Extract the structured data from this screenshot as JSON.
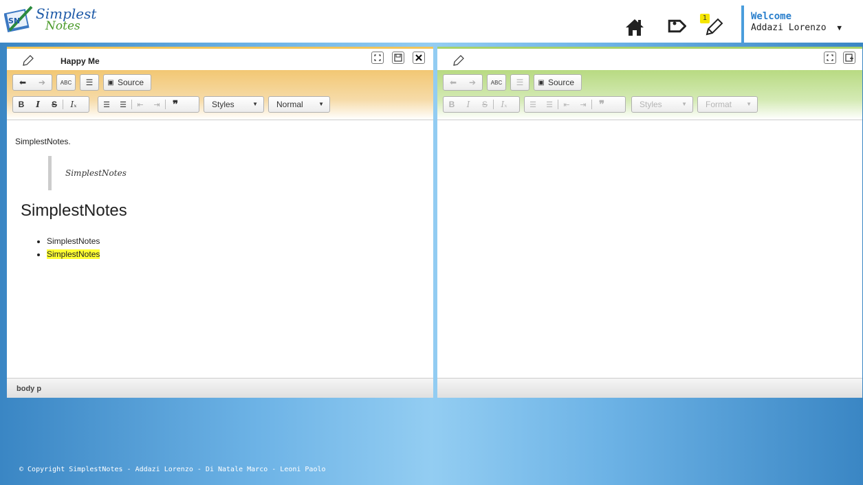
{
  "header": {
    "logo_line1": "Simplest",
    "logo_line2": "Notes",
    "logo_badge": "SN",
    "notification_count": "1",
    "welcome_title": "Welcome",
    "user_name": "Addazi Lorenzo",
    "caret": "▼"
  },
  "left_editor": {
    "title": "Happy Me",
    "toolbar": {
      "spellcheck": "ABC",
      "source_label": "Source",
      "bold": "B",
      "italic": "I",
      "strike": "S",
      "remove_format": "Iₓ",
      "blockquote": "❞",
      "styles_label": "Styles",
      "format_label": "Normal"
    },
    "content": {
      "paragraph": "SimplestNotes.",
      "quote": "SimplestNotes",
      "heading": "SimplestNotes",
      "list": [
        "SimplestNotes",
        "SimplestNotes"
      ]
    },
    "status_path": "body  p"
  },
  "right_editor": {
    "toolbar": {
      "spellcheck": "ABC",
      "source_label": "Source",
      "bold": "B",
      "italic": "I",
      "strike": "S",
      "remove_format": "Iₓ",
      "blockquote": "❞",
      "styles_label": "Styles",
      "format_label": "Format"
    }
  },
  "footer": {
    "copyright": "© Copyright SimplestNotes - Addazi Lorenzo - Di Natale Marco - Leoni Paolo"
  },
  "colors": {
    "left_accent": "#f2c55a",
    "right_accent": "#a8d26a",
    "brand_blue": "#2a7fcc",
    "highlight": "#ffff33"
  }
}
